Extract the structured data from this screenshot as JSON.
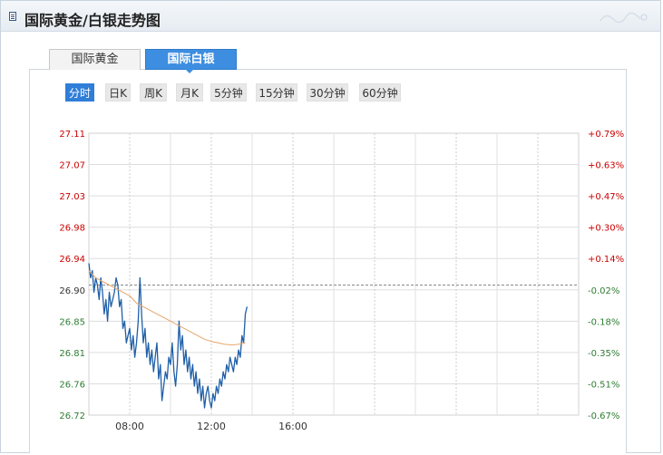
{
  "header": {
    "title": "国际黄金/白银走势图"
  },
  "tabs": [
    {
      "label": "国际黄金",
      "active": false
    },
    {
      "label": "国际白银",
      "active": true
    }
  ],
  "periods": [
    {
      "label": "分时",
      "active": true
    },
    {
      "label": "日K",
      "active": false
    },
    {
      "label": "周K",
      "active": false
    },
    {
      "label": "月K",
      "active": false
    },
    {
      "label": "5分钟",
      "active": false
    },
    {
      "label": "15分钟",
      "active": false
    },
    {
      "label": "30分钟",
      "active": false
    },
    {
      "label": "60分钟",
      "active": false
    }
  ],
  "colors": {
    "accent": "#2f7ed8",
    "price_line": "#1f5fa8",
    "average_line": "#e8a56a",
    "up": "#cc0000",
    "down": "#2e7d32"
  },
  "chart_data": {
    "type": "line",
    "title": "",
    "xlabel": "",
    "ylabel": "",
    "ylim": [
      26.72,
      27.11
    ],
    "previous_close": 26.9,
    "y_ticks_left": [
      "27.11",
      "27.07",
      "27.03",
      "26.98",
      "26.94",
      "26.90",
      "26.85",
      "26.81",
      "26.76",
      "26.72"
    ],
    "y_ticks_right": [
      "+0.79%",
      "+0.63%",
      "+0.47%",
      "+0.30%",
      "+0.14%",
      "-0.02%",
      "-0.18%",
      "-0.35%",
      "-0.51%",
      "-0.67%"
    ],
    "x_ticks": [
      "08:00",
      "12:00",
      "16:00"
    ],
    "x_tick_times": [
      "08:00",
      "12:00",
      "16:00"
    ],
    "x_range": [
      "06:00",
      "06:00 (+1d)"
    ],
    "grid": true,
    "series": [
      {
        "type": "line",
        "x": [
          "06:00",
          "06:05",
          "06:10",
          "06:15",
          "06:20",
          "06:25",
          "06:30",
          "06:35",
          "06:40",
          "06:45",
          "06:50",
          "06:55",
          "07:00",
          "07:05",
          "07:10",
          "07:15",
          "07:20",
          "07:25",
          "07:30",
          "07:35",
          "07:40",
          "07:45",
          "07:50",
          "07:55",
          "08:00",
          "08:05",
          "08:10",
          "08:15",
          "08:20",
          "08:25",
          "08:30",
          "08:35",
          "08:40",
          "08:45",
          "08:50",
          "08:55",
          "09:00",
          "09:05",
          "09:10",
          "09:15",
          "09:20",
          "09:25",
          "09:30",
          "09:35",
          "09:40",
          "09:45",
          "09:50",
          "09:55",
          "10:00",
          "10:05",
          "10:10",
          "10:15",
          "10:20",
          "10:25",
          "10:30",
          "10:35",
          "10:40",
          "10:45",
          "10:50",
          "10:55",
          "11:00",
          "11:05",
          "11:10",
          "11:15",
          "11:20",
          "11:25",
          "11:30",
          "11:35",
          "11:40",
          "11:45",
          "11:50",
          "11:55",
          "12:00",
          "12:05",
          "12:10",
          "12:15",
          "12:20",
          "12:25",
          "12:30",
          "12:35",
          "12:40",
          "12:45",
          "12:50",
          "12:55",
          "13:00",
          "13:05",
          "13:10",
          "13:15",
          "13:20",
          "13:25",
          "13:30",
          "13:35",
          "13:40",
          "13:45"
        ],
        "values": [
          26.93,
          26.91,
          26.92,
          26.89,
          26.91,
          26.9,
          26.88,
          26.91,
          26.89,
          26.86,
          26.88,
          26.85,
          26.89,
          26.87,
          26.88,
          26.89,
          26.91,
          26.9,
          26.87,
          26.88,
          26.84,
          26.85,
          26.82,
          26.83,
          26.84,
          26.81,
          26.83,
          26.8,
          26.82,
          26.85,
          26.91,
          26.86,
          26.82,
          26.84,
          26.8,
          26.82,
          26.79,
          26.81,
          26.78,
          26.8,
          26.82,
          26.77,
          26.79,
          26.74,
          26.76,
          26.78,
          26.77,
          26.8,
          26.79,
          26.82,
          26.78,
          26.76,
          26.79,
          26.85,
          26.81,
          26.83,
          26.79,
          26.81,
          26.78,
          26.8,
          26.77,
          26.79,
          26.76,
          26.78,
          26.75,
          26.77,
          26.74,
          26.76,
          26.73,
          26.75,
          26.76,
          26.74,
          26.73,
          26.75,
          26.74,
          26.76,
          26.75,
          26.77,
          26.76,
          26.78,
          26.77,
          26.79,
          26.78,
          26.8,
          26.79,
          26.78,
          26.8,
          26.79,
          26.81,
          26.8,
          26.83,
          26.82,
          26.86,
          26.87
        ]
      },
      {
        "type": "line",
        "x": [
          "06:00",
          "06:20",
          "06:40",
          "07:00",
          "07:20",
          "07:40",
          "08:00",
          "08:20",
          "08:40",
          "09:00",
          "09:20",
          "09:40",
          "10:00",
          "10:20",
          "10:40",
          "11:00",
          "11:20",
          "11:40",
          "12:00",
          "12:20",
          "12:40",
          "13:00",
          "13:20",
          "13:40"
        ],
        "values": [
          26.92,
          26.91,
          26.905,
          26.9,
          26.895,
          26.89,
          26.885,
          26.875,
          26.87,
          26.865,
          26.86,
          26.855,
          26.85,
          26.845,
          26.84,
          26.835,
          26.83,
          26.825,
          26.822,
          26.82,
          26.818,
          26.817,
          26.818,
          26.82
        ]
      }
    ]
  }
}
